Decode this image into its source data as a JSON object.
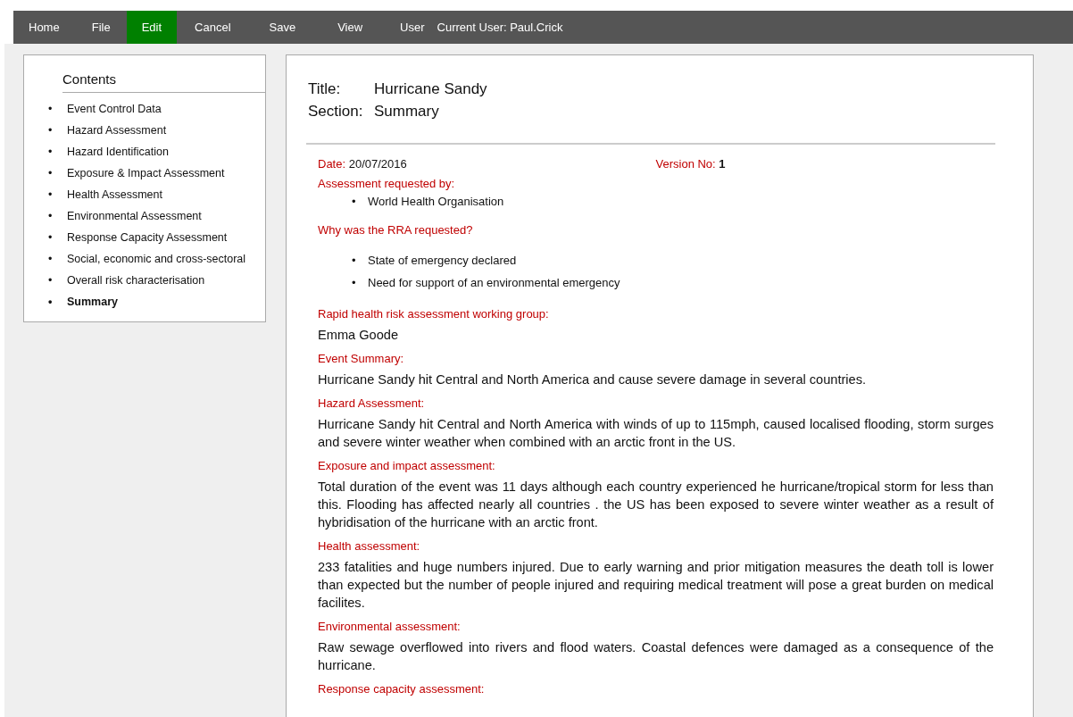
{
  "menu": [
    {
      "label": "Home",
      "selected": false
    },
    {
      "label": "File",
      "selected": false
    },
    {
      "label": "Edit",
      "selected": true
    },
    {
      "label": "Cancel",
      "selected": false
    },
    {
      "label": "Save",
      "selected": false
    },
    {
      "label": "View",
      "selected": false
    },
    {
      "label": "User",
      "selected": false
    }
  ],
  "current_user": "Current User: Paul.Crick",
  "sidebar": {
    "title": "Contents",
    "items": [
      {
        "bullet": "•",
        "label": "Event Control Data",
        "selected": false
      },
      {
        "bullet": "•",
        "label": "Hazard Assessment",
        "selected": false
      },
      {
        "bullet": "•",
        "label": "Hazard Identification",
        "selected": false
      },
      {
        "bullet": "•",
        "label": "Exposure & Impact Assessment",
        "selected": false
      },
      {
        "bullet": "•",
        "label": "Health Assessment",
        "selected": false
      },
      {
        "bullet": "•",
        "label": "Environmental Assessment",
        "selected": false
      },
      {
        "bullet": "•",
        "label": "Response Capacity Assessment",
        "selected": false
      },
      {
        "bullet": "•",
        "label": "Social, economic and cross-sectoral",
        "selected": false
      },
      {
        "bullet": "•",
        "label": "Overall risk characterisation",
        "selected": false
      },
      {
        "bullet": "•",
        "label": "Summary",
        "selected": true
      }
    ]
  },
  "header": {
    "title_label": "Title:",
    "title": "Hurricane Sandy",
    "section_label": "Section:",
    "section": "Summary"
  },
  "date": {
    "label": "Date:",
    "value": "20/07/2016"
  },
  "version": {
    "label": "Version No:",
    "value": "1"
  },
  "sections": [
    {
      "kind": "list",
      "label": "Assessment requested by:",
      "items": [
        {
          "bullet": "•",
          "text": "World Health Organisation"
        }
      ]
    },
    {
      "kind": "list",
      "label": "Why was the RRA requested?",
      "items": [
        {
          "bullet": "•",
          "text": "State of emergency declared"
        },
        {
          "bullet": "•",
          "text": "Need for support of an environmental emergency"
        }
      ]
    },
    {
      "kind": "text",
      "label": "Rapid health risk assessment working group:",
      "text": "Emma Goode"
    },
    {
      "kind": "text",
      "label": "Event Summary:",
      "text": "Hurricane Sandy hit Central and North America and cause severe damage in several countries."
    },
    {
      "kind": "text",
      "label": "Hazard Assessment:",
      "text": "Hurricane Sandy hit Central and North America with winds of up to 115mph, caused localised flooding, storm surges and severe winter weather when combined with an arctic front in the US."
    },
    {
      "kind": "text",
      "label": "Exposure and impact assessment:",
      "text": "Total duration of the event was 11 days although each country experienced he hurricane/tropical storm for less than this. Flooding has affected nearly all countries . the US has been exposed to severe winter weather as a result of hybridisation of the hurricane with an arctic front."
    },
    {
      "kind": "text",
      "label": "Health assessment:",
      "text": "233 fatalities and huge numbers injured. Due to early warning and prior mitigation measures the death toll is lower than expected but the number of people injured and requiring medical treatment will pose a great burden on medical facilites."
    },
    {
      "kind": "text",
      "label": "Environmental assessment:",
      "text": "Raw sewage overflowed into rivers and flood waters. Coastal defences were damaged as a consequence of the hurricane."
    },
    {
      "kind": "label",
      "label": "Response capacity assessment:"
    }
  ]
}
